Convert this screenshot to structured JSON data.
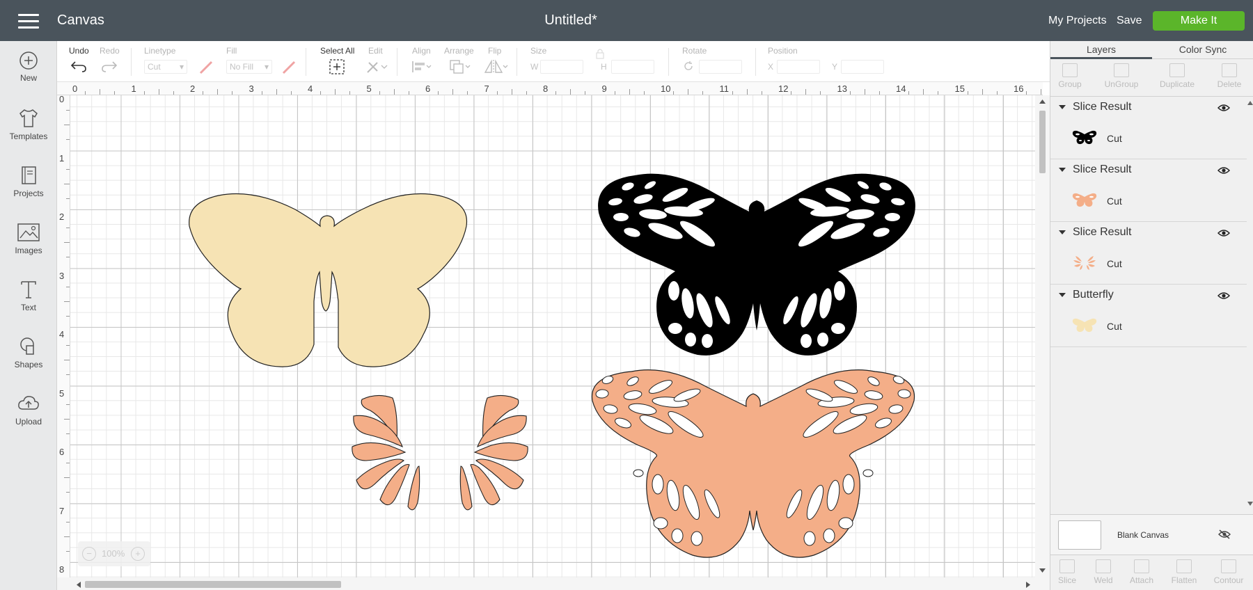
{
  "topbar": {
    "app_title": "Canvas",
    "document_title": "Untitled*",
    "my_projects": "My Projects",
    "save": "Save",
    "make_it": "Make It"
  },
  "sidebar": {
    "items": [
      {
        "label": "New",
        "icon": "plus-circle-icon"
      },
      {
        "label": "Templates",
        "icon": "tshirt-icon"
      },
      {
        "label": "Projects",
        "icon": "book-icon"
      },
      {
        "label": "Images",
        "icon": "image-icon"
      },
      {
        "label": "Text",
        "icon": "text-icon"
      },
      {
        "label": "Shapes",
        "icon": "shapes-icon"
      },
      {
        "label": "Upload",
        "icon": "cloud-upload-icon"
      }
    ]
  },
  "toolbar": {
    "undo": "Undo",
    "redo": "Redo",
    "linetype_label": "Linetype",
    "linetype_value": "Cut",
    "fill_label": "Fill",
    "fill_value": "No Fill",
    "select_all": "Select All",
    "edit": "Edit",
    "align": "Align",
    "arrange": "Arrange",
    "flip": "Flip",
    "size": "Size",
    "size_w": "W",
    "size_h": "H",
    "rotate": "Rotate",
    "position": "Position",
    "pos_x": "X",
    "pos_y": "Y"
  },
  "rulers": {
    "top": [
      "0",
      "1",
      "2",
      "3",
      "4",
      "5",
      "6",
      "7",
      "8",
      "9",
      "10",
      "11",
      "12",
      "13",
      "14",
      "15",
      "16"
    ],
    "left": [
      "0",
      "1",
      "2",
      "3",
      "4",
      "5",
      "6",
      "7",
      "8"
    ]
  },
  "zoom": {
    "value": "100%",
    "minus": "−",
    "plus": "+"
  },
  "colors": {
    "topbar": "#4a545c",
    "make_it": "#5bb52a",
    "butterfly_cream": "#f6e3b4",
    "butterfly_black": "#000000",
    "butterfly_peach": "#f4ae88"
  },
  "right_panel": {
    "tabs": [
      "Layers",
      "Color Sync"
    ],
    "actions": [
      "Group",
      "UnGroup",
      "Duplicate",
      "Delete"
    ],
    "layers": [
      {
        "name": "Slice Result",
        "operation": "Cut",
        "color": "#000000"
      },
      {
        "name": "Slice Result",
        "operation": "Cut",
        "color": "#f4ae88"
      },
      {
        "name": "Slice Result",
        "operation": "Cut",
        "color": "#f4ae88"
      },
      {
        "name": "Butterfly",
        "operation": "Cut",
        "color": "#f6e3b4"
      }
    ],
    "blank_canvas": "Blank Canvas",
    "bottom_actions": [
      "Slice",
      "Weld",
      "Attach",
      "Flatten",
      "Contour"
    ]
  }
}
